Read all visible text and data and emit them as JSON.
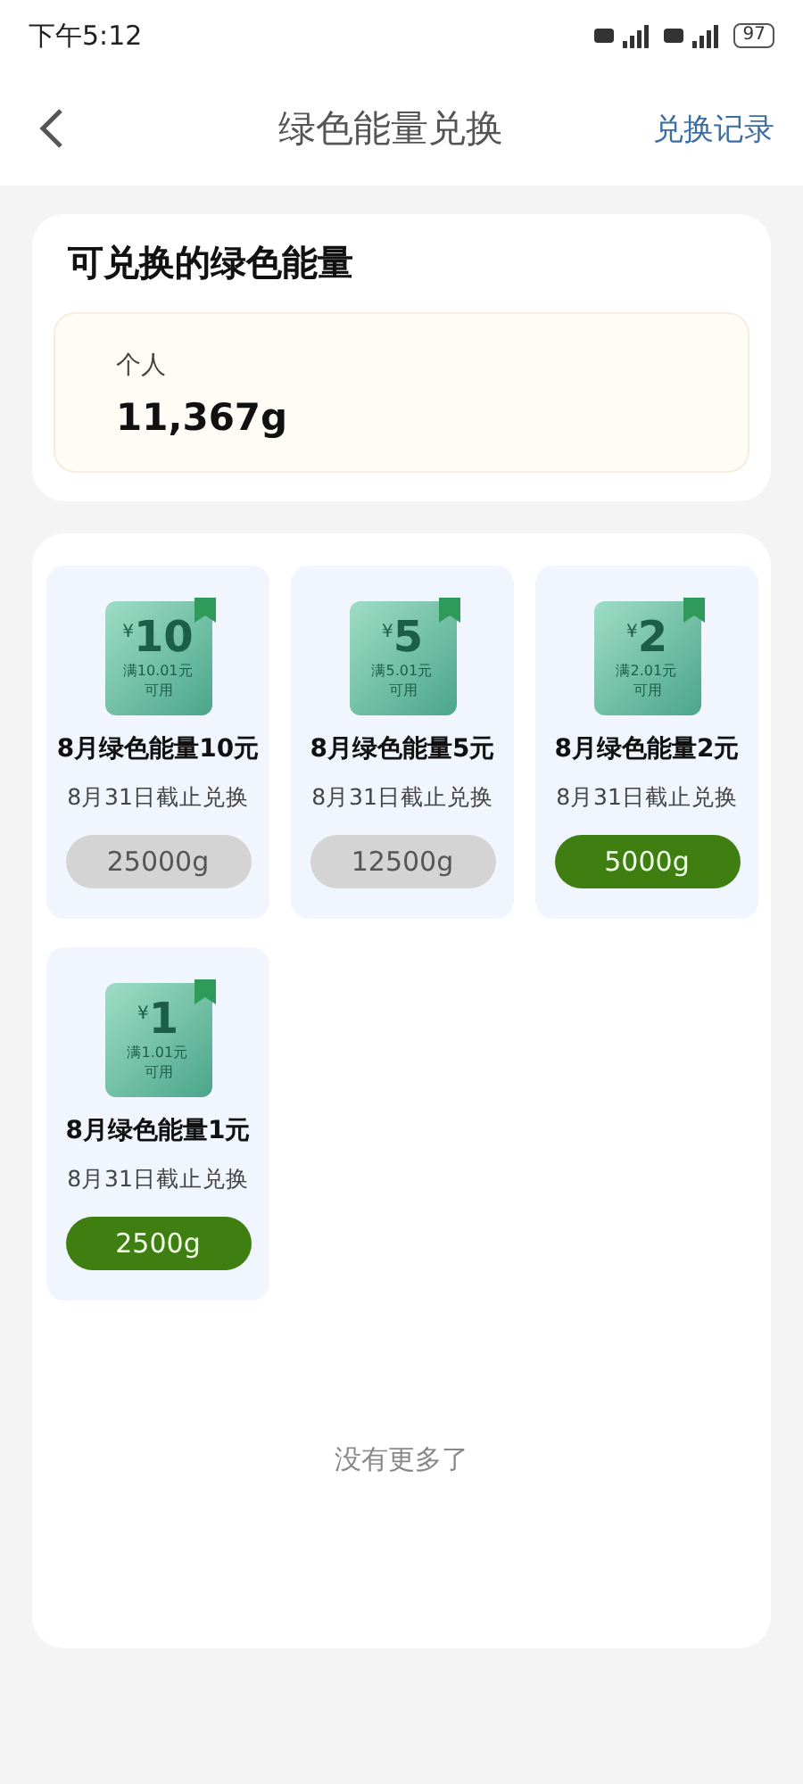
{
  "status_bar": {
    "time": "下午5:12",
    "battery": "97"
  },
  "header": {
    "title": "绿色能量兑换",
    "action": "兑换记录"
  },
  "balance": {
    "title": "可兑换的绿色能量",
    "label": "个人",
    "value": "11,367g"
  },
  "items": [
    {
      "currency": "¥",
      "amount": "10",
      "condition": "满10.01元",
      "usable": "可用",
      "name": "8月绿色能量10元",
      "deadline": "8月31日截止兑换",
      "price": "25000g",
      "disabled": true
    },
    {
      "currency": "¥",
      "amount": "5",
      "condition": "满5.01元",
      "usable": "可用",
      "name": "8月绿色能量5元",
      "deadline": "8月31日截止兑换",
      "price": "12500g",
      "disabled": true
    },
    {
      "currency": "¥",
      "amount": "2",
      "condition": "满2.01元",
      "usable": "可用",
      "name": "8月绿色能量2元",
      "deadline": "8月31日截止兑换",
      "price": "5000g",
      "disabled": false
    },
    {
      "currency": "¥",
      "amount": "1",
      "condition": "满1.01元",
      "usable": "可用",
      "name": "8月绿色能量1元",
      "deadline": "8月31日截止兑换",
      "price": "2500g",
      "disabled": false
    }
  ],
  "footer": "没有更多了"
}
